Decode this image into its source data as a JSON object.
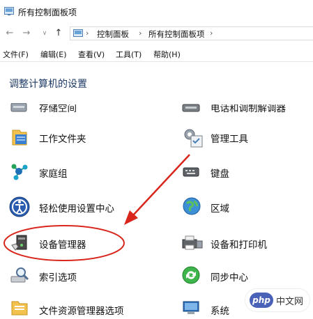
{
  "window": {
    "title": "所有控制面板项"
  },
  "address": {
    "crumbs": [
      "控制面板",
      "所有控制面板项"
    ]
  },
  "menu": [
    "文件(F)",
    "编辑(E)",
    "查看(V)",
    "工具(T)",
    "帮助(H)"
  ],
  "heading": "调整计算机的设置",
  "items_left": [
    {
      "label": "存储空间",
      "icon": "storage-icon"
    },
    {
      "label": "工作文件夹",
      "icon": "work-folders-icon"
    },
    {
      "label": "家庭组",
      "icon": "homegroup-icon"
    },
    {
      "label": "轻松使用设置中心",
      "icon": "ease-of-access-icon"
    },
    {
      "label": "设备管理器",
      "icon": "device-manager-icon"
    },
    {
      "label": "索引选项",
      "icon": "indexing-options-icon"
    },
    {
      "label": "文件资源管理器选项",
      "icon": "file-explorer-options-icon"
    }
  ],
  "items_right": [
    {
      "label": "电话和调制解调器",
      "icon": "phone-modem-icon"
    },
    {
      "label": "管理工具",
      "icon": "admin-tools-icon"
    },
    {
      "label": "键盘",
      "icon": "keyboard-icon"
    },
    {
      "label": "区域",
      "icon": "region-icon"
    },
    {
      "label": "设备和打印机",
      "icon": "devices-printers-icon"
    },
    {
      "label": "同步中心",
      "icon": "sync-center-icon"
    },
    {
      "label": "系统",
      "icon": "system-icon"
    }
  ],
  "watermark": {
    "badge": "php",
    "text": "中文网"
  },
  "colors": {
    "annotation": "#d9261c",
    "heading": "#1e3a66"
  }
}
